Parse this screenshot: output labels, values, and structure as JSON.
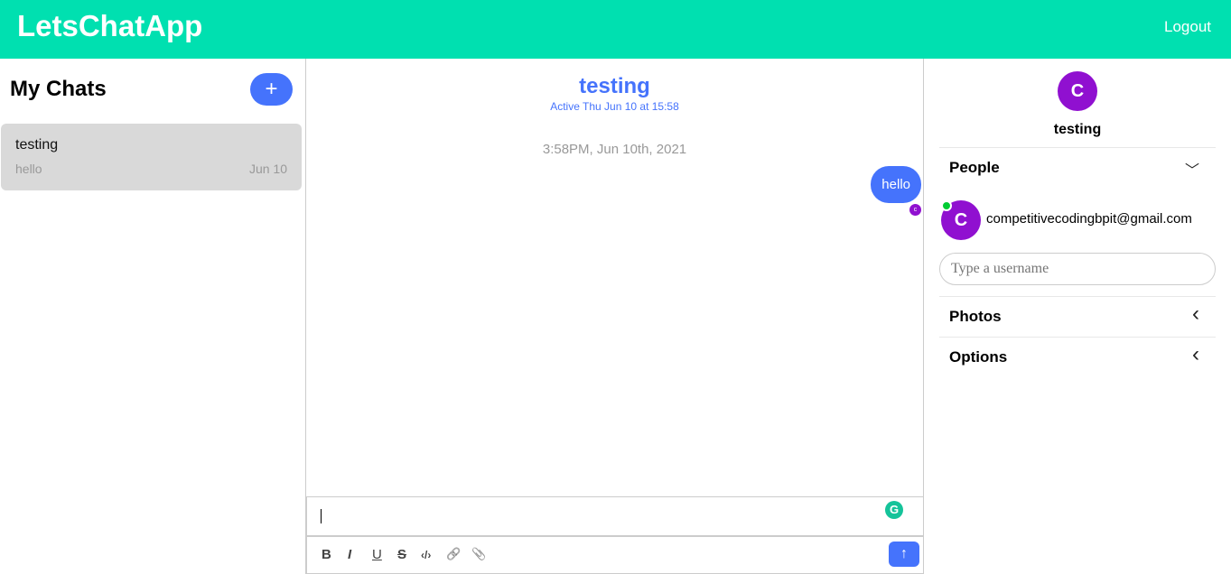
{
  "header": {
    "brand": "LetsChatApp",
    "logout": "Logout"
  },
  "sidebar": {
    "title": "My Chats",
    "add_label": "+",
    "chats": [
      {
        "title": "testing",
        "preview": "hello",
        "date": "Jun 10"
      }
    ]
  },
  "chat": {
    "title": "testing",
    "subtitle": "Active Thu Jun 10 at 15:58",
    "timestamp": "3:58PM, Jun 10th, 2021",
    "messages": [
      {
        "text": "hello",
        "reader_initial": "c"
      }
    ],
    "grammarly": "G",
    "toolbar": {
      "bold": "B",
      "italic": "I",
      "underline": "U",
      "strike": "S",
      "code": "‹/›",
      "link": "🔗",
      "attach": "📎",
      "send": "↑"
    }
  },
  "details": {
    "avatar": "C",
    "name": "testing",
    "people_label": "People",
    "people": [
      {
        "initial": "C",
        "email": "competitivecodingbpit@gmail.com"
      }
    ],
    "username_placeholder": "Type a username",
    "photos_label": "Photos",
    "options_label": "Options",
    "chev_down": "﹀",
    "chev_left": "‹"
  },
  "colors": {
    "brand": "#00e0b0",
    "accent": "#4573fc",
    "avatar": "#9010d0"
  }
}
